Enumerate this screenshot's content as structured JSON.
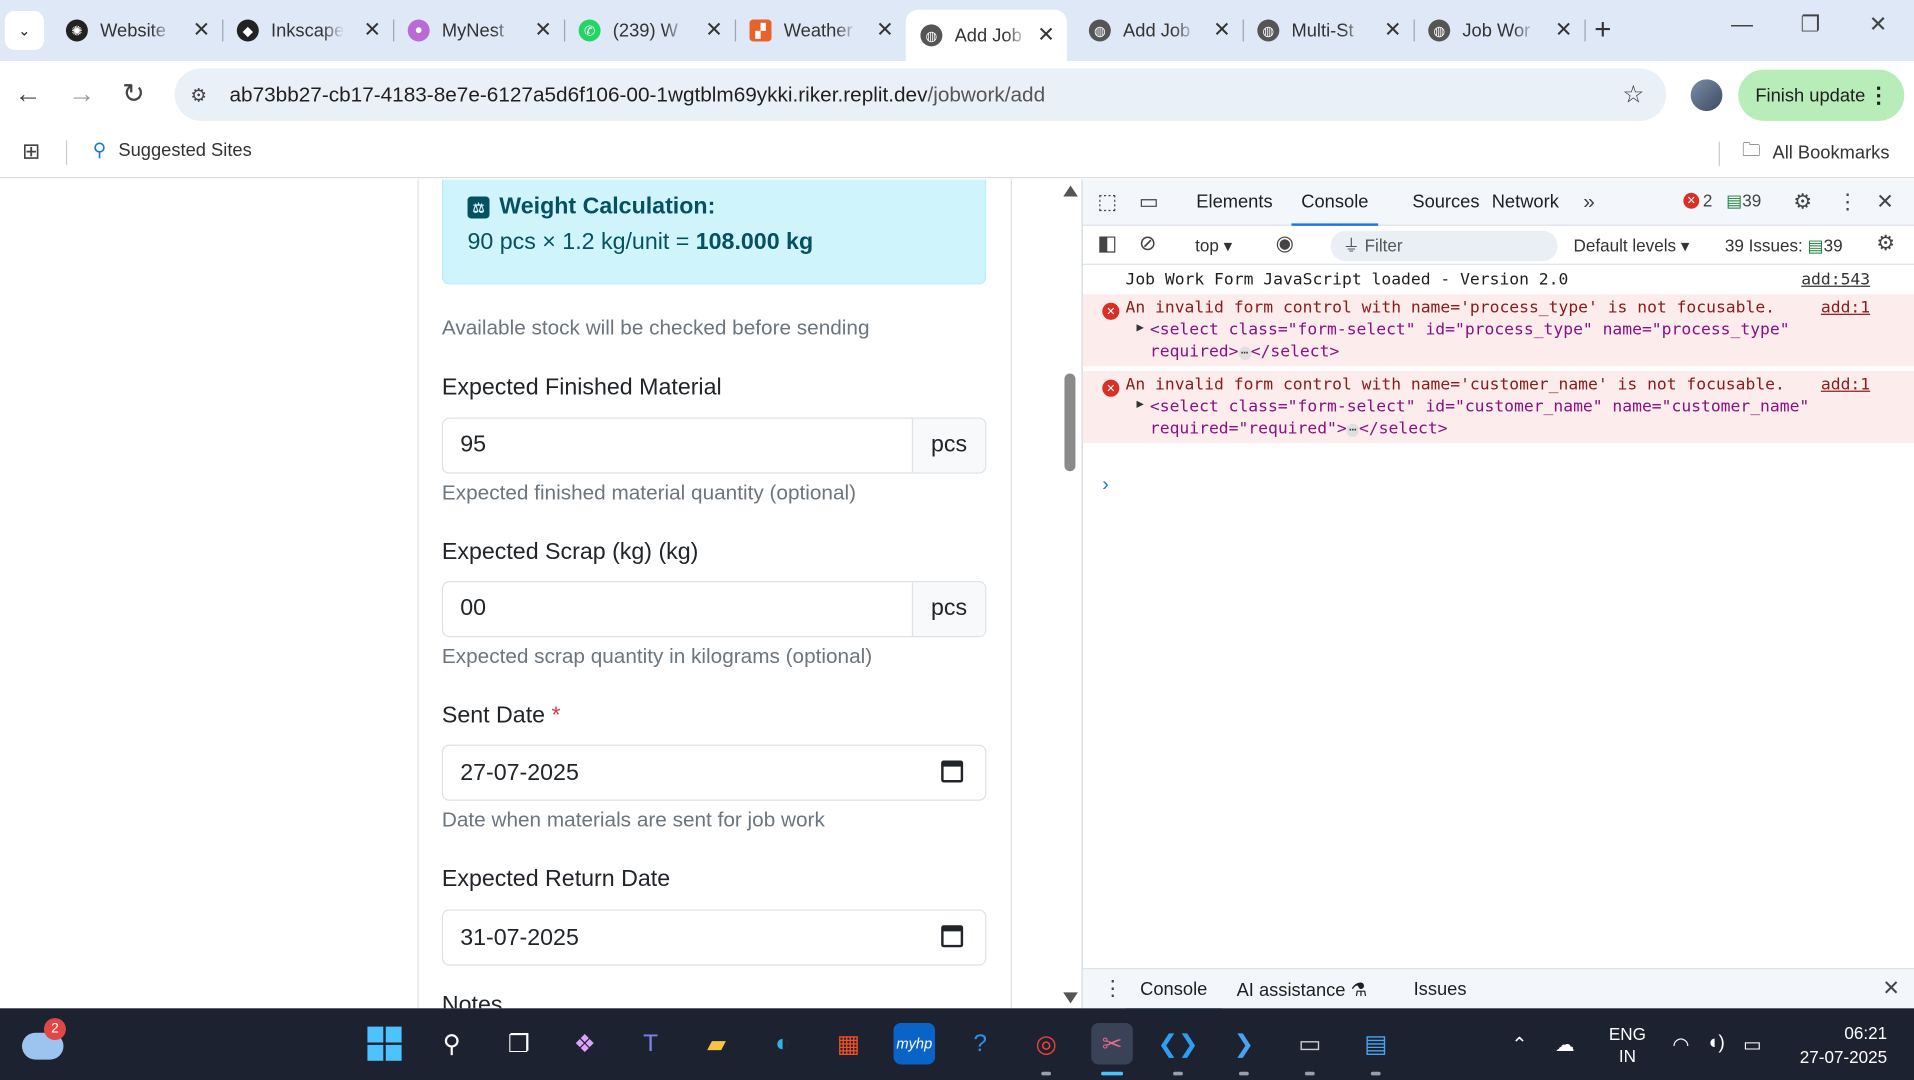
{
  "tabs": [
    {
      "title": "Website",
      "fav": "openai-icon",
      "color": "#222222"
    },
    {
      "title": "Inkscape",
      "fav": "inkscape-icon",
      "color": "#222222"
    },
    {
      "title": "MyNest",
      "fav": "mynest-icon",
      "color": "#b86bd4"
    },
    {
      "title": "(239) W",
      "fav": "whatsapp-icon",
      "color": "#25d366"
    },
    {
      "title": "Weather",
      "fav": "weather-icon",
      "color": "#e8632b"
    },
    {
      "title": "Add Job",
      "fav": "globe-icon",
      "color": "#555555"
    },
    {
      "title": "Add Job",
      "fav": "globe-icon",
      "color": "#555555"
    },
    {
      "title": "Multi-St",
      "fav": "globe-icon",
      "color": "#555555"
    },
    {
      "title": "Job Wor",
      "fav": "globe-icon",
      "color": "#555555"
    }
  ],
  "url": {
    "host": "ab73bb27-cb17-4183-8e7e-6127a5d6f106-00-1wgtblm69ykki.riker.replit.dev",
    "path": "/jobwork/add"
  },
  "finish_update": "Finish update",
  "bookmarks": {
    "suggested": "Suggested Sites",
    "all": "All Bookmarks"
  },
  "form": {
    "weight_title": "Weight Calculation:",
    "weight_formula": "90 pcs × 1.2 kg/unit = ",
    "weight_result": "108.000 kg",
    "stock_note": "Available stock will be checked before sending",
    "finished_label": "Expected Finished Material",
    "finished_value": "95",
    "finished_unit": "pcs",
    "finished_help": "Expected finished material quantity (optional)",
    "scrap_label": "Expected Scrap (kg) (kg)",
    "scrap_value": "00",
    "scrap_unit": "pcs",
    "scrap_help": "Expected scrap quantity in kilograms (optional)",
    "sent_label": "Sent Date",
    "required_mark": "*",
    "sent_value": "27-07-2025",
    "sent_help": "Date when materials are sent for job work",
    "return_label": "Expected Return Date",
    "return_value": "31-07-2025",
    "notes_label": "Notes"
  },
  "devtools": {
    "tabs": [
      "Elements",
      "Console",
      "Sources",
      "Network"
    ],
    "active_tab": "Console",
    "errors": "2",
    "messages": "39",
    "context": "top",
    "filter_placeholder": "Filter",
    "levels": "Default levels",
    "issues": "39 Issues:",
    "issues_count": "39",
    "log": [
      {
        "text": "Job Work Form JavaScript loaded - Version 2.0",
        "src": "add:543"
      }
    ],
    "errors_list": [
      {
        "text": "An invalid form control with name='process_type' is not focusable.",
        "src": "add:1",
        "line1": "<select class=\"form-select\" id=\"process_type\" name=\"process_type\"",
        "line2": "required>",
        "line2_end": "</select>"
      },
      {
        "text": "An invalid form control with name='customer_name' is not focusable.",
        "src": "add:1",
        "line1": "<select class=\"form-select\" id=\"customer_name\" name=\"customer_name\"",
        "line2": "required=\"required\">",
        "line2_end": "</select>"
      }
    ],
    "bottom_tabs": [
      "Console",
      "AI assistance",
      "Issues"
    ]
  },
  "taskbar": {
    "weather_badge": "2",
    "lang_top": "ENG",
    "lang_bottom": "IN",
    "time": "06:21",
    "date": "27-07-2025"
  }
}
